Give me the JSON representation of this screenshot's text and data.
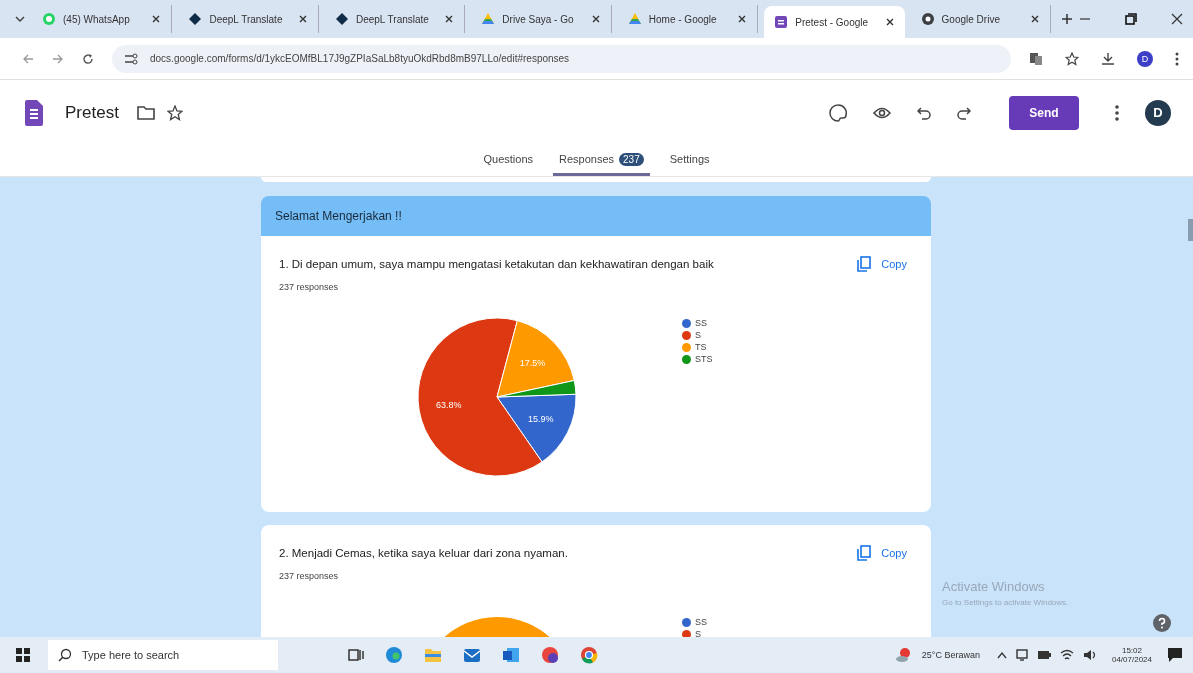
{
  "browser": {
    "tabs": [
      {
        "title": "(45) WhatsApp",
        "kind": "whatsapp",
        "selected": false
      },
      {
        "title": "DeepL Translate",
        "kind": "deepl",
        "selected": false
      },
      {
        "title": "DeepL Translate",
        "kind": "deepl",
        "selected": false
      },
      {
        "title": "Drive Saya - Go",
        "kind": "drive",
        "selected": false
      },
      {
        "title": "Home - Google",
        "kind": "drive",
        "selected": false
      },
      {
        "title": "Pretest - Google",
        "kind": "forms",
        "selected": true
      },
      {
        "title": "Google Drive",
        "kind": "chrome",
        "selected": false
      }
    ],
    "url": "docs.google.com/forms/d/1ykcEOMfBL17J9gZPIaSaLb8tyuOkdRbd8mB97LLo/edit#responses",
    "profile": "D"
  },
  "form": {
    "title": "Pretest",
    "send": "Send",
    "avatar": "D",
    "tabs": [
      {
        "label": "Questions",
        "selected": false
      },
      {
        "label": "Responses",
        "badge": "237",
        "selected": true
      },
      {
        "label": "Settings",
        "selected": false
      }
    ]
  },
  "section": {
    "title": "Selamat Mengerjakan !!"
  },
  "questions": [
    {
      "title": "1. Di depan umum, saya mampu mengatasi ketakutan dan kekhawatiran dengan baik",
      "copy": "Copy",
      "count": "237 responses",
      "chart_data": {
        "type": "pie",
        "categories": [
          "SS",
          "S",
          "TS",
          "STS"
        ],
        "values": [
          15.9,
          63.8,
          17.5,
          2.8
        ],
        "colors": [
          "#3366cc",
          "#dc3912",
          "#ff9900",
          "#109618"
        ],
        "value_labels": [
          "15.9%",
          "63.8%",
          "17.5%",
          null
        ]
      }
    },
    {
      "title": "2. Menjadi Cemas, ketika saya keluar dari zona nyaman.",
      "copy": "Copy",
      "count": "237 responses",
      "legend": [
        {
          "label": "SS",
          "color": "#3366cc"
        },
        {
          "label": "S",
          "color": "#dc3912"
        }
      ]
    }
  ],
  "watermark": {
    "title": "Activate Windows",
    "hint": "Go to Settings to activate Windows."
  },
  "taskbar": {
    "search": "Type here to search",
    "weather": "25°C Berawan",
    "time": "15:02",
    "date": "04/07/2024"
  }
}
